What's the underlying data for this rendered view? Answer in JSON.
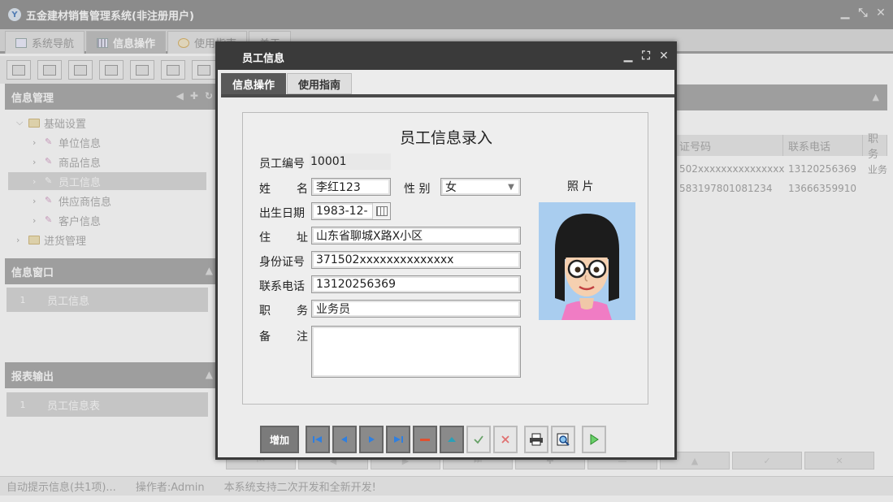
{
  "app": {
    "title": "五金建材销售管理系统(非注册用户)",
    "title_icon": "app-logo-icon",
    "tabs": [
      {
        "label": "系统导航",
        "icon": "monitor-icon"
      },
      {
        "label": "信息操作",
        "icon": "grid-icon"
      },
      {
        "label": "使用指南",
        "icon": "clock-icon"
      },
      {
        "label": "关于",
        "icon": ""
      }
    ]
  },
  "sidebar": {
    "info_mgmt": {
      "title": "信息管理",
      "tree": [
        {
          "label": "基础设置",
          "level": 0,
          "type": "folder",
          "expanded": true
        },
        {
          "label": "单位信息",
          "level": 1,
          "type": "leaf"
        },
        {
          "label": "商品信息",
          "level": 1,
          "type": "leaf"
        },
        {
          "label": "员工信息",
          "level": 1,
          "type": "leaf",
          "selected": true
        },
        {
          "label": "供应商信息",
          "level": 1,
          "type": "leaf"
        },
        {
          "label": "客户信息",
          "level": 1,
          "type": "leaf"
        },
        {
          "label": "进货管理",
          "level": 0,
          "type": "folder",
          "expanded": false
        }
      ]
    },
    "info_window": {
      "title": "信息窗口",
      "items": [
        {
          "num": "1",
          "label": "员工信息"
        }
      ]
    },
    "report_output": {
      "title": "报表输出",
      "items": [
        {
          "num": "1",
          "label": "员工信息表"
        }
      ]
    }
  },
  "grid": {
    "columns": [
      "证号码",
      "联系电话",
      "职务"
    ],
    "rows": [
      [
        "502xxxxxxxxxxxxxxx",
        "13120256369",
        "业务"
      ],
      [
        "583197801081234",
        "13666359910",
        ""
      ]
    ]
  },
  "statusbar": {
    "hint": "自动提示信息(共1项)...",
    "operator": "操作者:Admin",
    "notice": "本系统支持二次开发和全新开发!"
  },
  "modal": {
    "title": "员工信息",
    "tabs": [
      {
        "label": "信息操作",
        "active": true
      },
      {
        "label": "使用指南",
        "active": false
      }
    ],
    "form": {
      "title": "员工信息录入",
      "emp_no_label": "员工编号",
      "emp_no_value": "10001",
      "name_label_1": "姓",
      "name_label_2": "名",
      "name_value": "李红123",
      "gender_label": "性 别",
      "gender_value": "女",
      "birth_label": "出生日期",
      "birth_value": "1983-12-",
      "address_label_1": "住",
      "address_label_2": "址",
      "address_value": "山东省聊城X路X小区",
      "id_label": "身份证号",
      "id_value": "371502xxxxxxxxxxxxxx",
      "phone_label": "联系电话",
      "phone_value": "13120256369",
      "job_label_1": "职",
      "job_label_2": "务",
      "job_value": "业务员",
      "remark_label_1": "备",
      "remark_label_2": "注",
      "remark_value": "",
      "photo_label": "照 片"
    },
    "buttons": {
      "add": "增加"
    }
  }
}
